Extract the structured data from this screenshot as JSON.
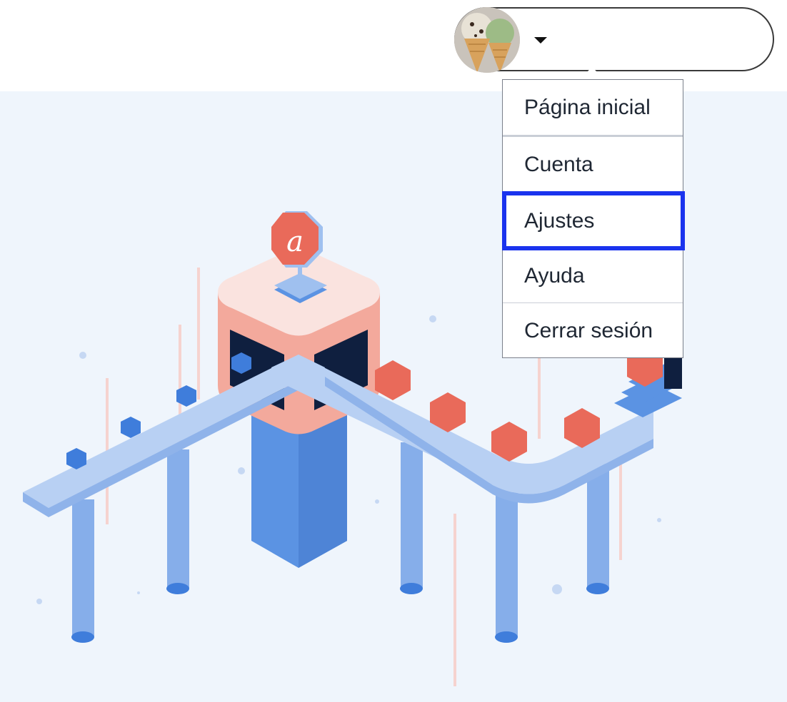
{
  "header": {
    "avatar_alt": "ice cream cones avatar",
    "caret_icon": "caret-down-icon"
  },
  "menu": {
    "items": [
      {
        "label": "Página inicial"
      },
      {
        "label": "Cuenta"
      },
      {
        "label": "Ajustes"
      },
      {
        "label": "Ayuda"
      },
      {
        "label": "Cerrar sesión"
      }
    ],
    "focused_item": "Ajustes"
  },
  "colors": {
    "focus": "#1a33ee",
    "hero_bg": "#eff5fc",
    "belt": "#b8d0f3",
    "pillar": "#5b93e3",
    "coral": "#e96a5a"
  }
}
